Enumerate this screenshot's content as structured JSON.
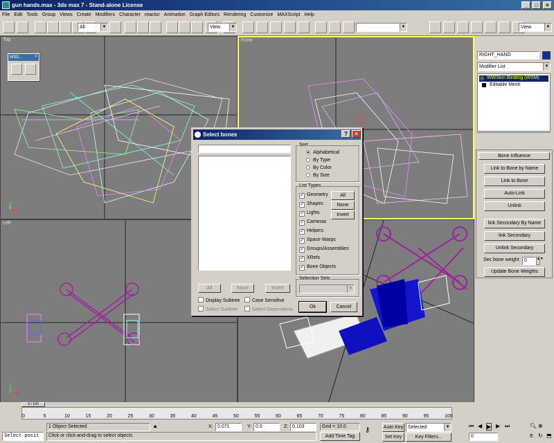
{
  "window": {
    "title": "gun hands.max - 3ds max 7 - Stand-alone License"
  },
  "menu": [
    "File",
    "Edit",
    "Tools",
    "Group",
    "Views",
    "Create",
    "Modifiers",
    "Character",
    "reactor",
    "Animation",
    "Graph Editors",
    "Rendering",
    "Customize",
    "MAXScript",
    "Help"
  ],
  "toolbar": {
    "selection_filter": "All",
    "ref_coord": "View",
    "named_selection": "",
    "viewport_mode": "View"
  },
  "viewports": {
    "top": "Top",
    "front": "Front",
    "left": "Left",
    "persp": ""
  },
  "floater": {
    "title": "W3D..."
  },
  "command_panel": {
    "object_name": "RIGHT_HAND",
    "modifier_list": "Modifier List",
    "stack": [
      "WWSkin Binding (WSM)",
      "Editable Mesh"
    ],
    "rollout_title": "Bone Influence",
    "buttons": [
      "Link to Bone by Name",
      "Link to Bone",
      "Auto-Link",
      "Unlink",
      "link Secondary By Name",
      "link Secondary",
      "Unlink Secondary"
    ],
    "sec_weight_label": "Sec bone weight",
    "sec_weight_value": "0",
    "update_button": "Update Bone Weights"
  },
  "dialog": {
    "title": "Select bones",
    "search_value": "",
    "sort_label": "Sort",
    "sort_options": [
      "Alphabetical",
      "By Type",
      "By Color",
      "By Size"
    ],
    "list_types_label": "List Types",
    "list_types": [
      "Geometry",
      "Shapes",
      "Lights",
      "Cameras",
      "Helpers",
      "Space Warps",
      "Groups/Assemblies",
      "XRefs",
      "Bone Objects"
    ],
    "type_buttons": [
      "All",
      "None",
      "Invert"
    ],
    "list_buttons": [
      "All",
      "None",
      "Invert"
    ],
    "display_subtree": "Display Subtree",
    "case_sensitive": "Case Sensitive",
    "select_subtree": "Select Subtree",
    "select_dependents": "Select Dependents",
    "selection_sets_label": "Selection Sets",
    "ok": "Ok",
    "cancel": "Cancel"
  },
  "timeline": {
    "slider": "0 / 100",
    "ticks": [
      "0",
      "5",
      "10",
      "15",
      "20",
      "25",
      "30",
      "35",
      "40",
      "45",
      "50",
      "55",
      "60",
      "65",
      "70",
      "75",
      "80",
      "85",
      "90",
      "95",
      "100"
    ]
  },
  "status": {
    "listener": "Select posit",
    "selected": "1 Object Selected",
    "prompt": "Click or click-and-drag to select objects",
    "x_label": "X:",
    "x_value": "0.071",
    "y_label": "Y:",
    "y_value": "0.0",
    "z_label": "Z:",
    "z_value": "0.103",
    "grid": "Grid = 10.0",
    "add_time_tag": "Add Time Tag",
    "auto_key": "Auto Key",
    "set_key": "Set Key",
    "key_mode": "Selected",
    "key_filters": "Key Filters...",
    "frame": "0"
  }
}
